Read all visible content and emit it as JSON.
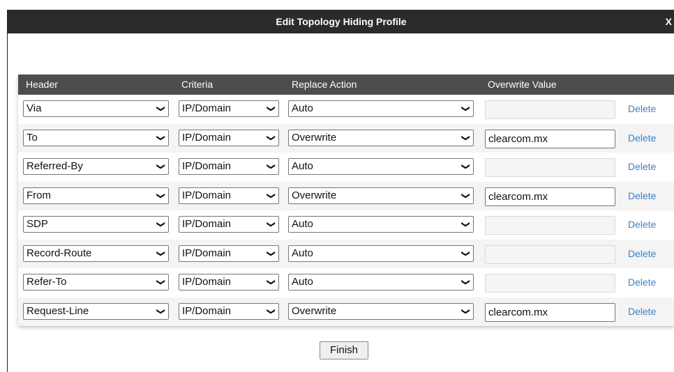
{
  "dialog": {
    "title": "Edit Topology Hiding Profile",
    "close_label": "X"
  },
  "table": {
    "headers": [
      "Header",
      "Criteria",
      "Replace Action",
      "Overwrite Value"
    ],
    "delete_label": "Delete",
    "rows": [
      {
        "header": "Via",
        "criteria": "IP/Domain",
        "action": "Auto",
        "overwrite": ""
      },
      {
        "header": "To",
        "criteria": "IP/Domain",
        "action": "Overwrite",
        "overwrite": "clearcom.mx"
      },
      {
        "header": "Referred-By",
        "criteria": "IP/Domain",
        "action": "Auto",
        "overwrite": ""
      },
      {
        "header": "From",
        "criteria": "IP/Domain",
        "action": "Overwrite",
        "overwrite": "clearcom.mx"
      },
      {
        "header": "SDP",
        "criteria": "IP/Domain",
        "action": "Auto",
        "overwrite": ""
      },
      {
        "header": "Record-Route",
        "criteria": "IP/Domain",
        "action": "Auto",
        "overwrite": ""
      },
      {
        "header": "Refer-To",
        "criteria": "IP/Domain",
        "action": "Auto",
        "overwrite": ""
      },
      {
        "header": "Request-Line",
        "criteria": "IP/Domain",
        "action": "Overwrite",
        "overwrite": "clearcom.mx"
      }
    ]
  },
  "finish_label": "Finish",
  "colors": {
    "titlebar": "#2b2b2b",
    "table_header": "#4d4d4d",
    "delete_link": "#3e82c4"
  }
}
